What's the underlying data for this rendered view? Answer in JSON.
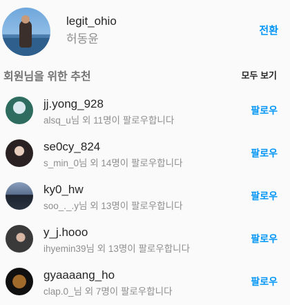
{
  "profile": {
    "username": "legit_ohio",
    "name": "허동윤",
    "switch_label": "전환"
  },
  "suggestions": {
    "title": "회원님을 위한 추천",
    "see_all_label": "모두 보기",
    "items": [
      {
        "username": "jj.yong_928",
        "subtitle": "alsq_u님 외 11명이 팔로우합니다",
        "follow_label": "팔로우"
      },
      {
        "username": "se0cy_824",
        "subtitle": "s_min_0님 외 14명이 팔로우합니다",
        "follow_label": "팔로우"
      },
      {
        "username": "ky0_hw",
        "subtitle": "soo_._.y님 외 13명이 팔로우합니다",
        "follow_label": "팔로우"
      },
      {
        "username": "y_j.hooo",
        "subtitle": "ihyemin39님 외 13명이 팔로우합니다",
        "follow_label": "팔로우"
      },
      {
        "username": "gyaaaang_ho",
        "subtitle": "clap.0_님 외 7명이 팔로우합니다",
        "follow_label": "팔로우"
      }
    ]
  },
  "colors": {
    "accent": "#0095f6",
    "primary_text": "#262626",
    "secondary_text": "#8e8e8e",
    "background": "#fafafa"
  }
}
